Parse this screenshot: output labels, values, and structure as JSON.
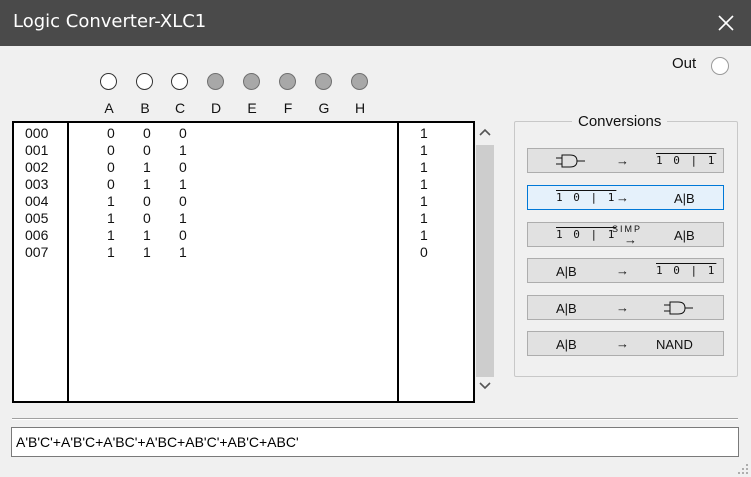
{
  "window": {
    "title": "Logic Converter-XLC1"
  },
  "out": {
    "label": "Out"
  },
  "inputs": [
    {
      "label": "A",
      "state": "on"
    },
    {
      "label": "B",
      "state": "on"
    },
    {
      "label": "C",
      "state": "on"
    },
    {
      "label": "D",
      "state": "off"
    },
    {
      "label": "E",
      "state": "off"
    },
    {
      "label": "F",
      "state": "off"
    },
    {
      "label": "G",
      "state": "off"
    },
    {
      "label": "H",
      "state": "off"
    }
  ],
  "truth_table": {
    "rows": [
      {
        "index": "000",
        "a": "0",
        "b": "0",
        "c": "0",
        "out": "1"
      },
      {
        "index": "001",
        "a": "0",
        "b": "0",
        "c": "1",
        "out": "1"
      },
      {
        "index": "002",
        "a": "0",
        "b": "1",
        "c": "0",
        "out": "1"
      },
      {
        "index": "003",
        "a": "0",
        "b": "1",
        "c": "1",
        "out": "1"
      },
      {
        "index": "004",
        "a": "1",
        "b": "0",
        "c": "0",
        "out": "1"
      },
      {
        "index": "005",
        "a": "1",
        "b": "0",
        "c": "1",
        "out": "1"
      },
      {
        "index": "006",
        "a": "1",
        "b": "1",
        "c": "0",
        "out": "1"
      },
      {
        "index": "007",
        "a": "1",
        "b": "1",
        "c": "1",
        "out": "0"
      }
    ]
  },
  "conversions": {
    "title": "Conversions",
    "buttons": [
      {
        "left": "",
        "left_icon": "gate-icon",
        "middle": "→",
        "right": "1 0 | 1",
        "active": false
      },
      {
        "left": "1 0 | 1",
        "middle": "→",
        "right": "A|B",
        "active": true
      },
      {
        "left": "1 0 | 1",
        "middle": "SIMP",
        "right": "A|B",
        "active": false
      },
      {
        "left": "A|B",
        "middle": "→",
        "right": "1 0 | 1",
        "active": false
      },
      {
        "left": "A|B",
        "middle": "→",
        "right": "",
        "right_icon": "gate-icon",
        "active": false
      },
      {
        "left": "A|B",
        "middle": "→",
        "right": "NAND",
        "active": false
      }
    ]
  },
  "expression": {
    "value": "A'B'C'+A'B'C+A'BC'+A'BC+AB'C'+AB'C+ABC'"
  },
  "colors": {
    "titlebar": "#4a4a4a",
    "active_border": "#0078d7",
    "led_off": "#a8a8a8"
  }
}
